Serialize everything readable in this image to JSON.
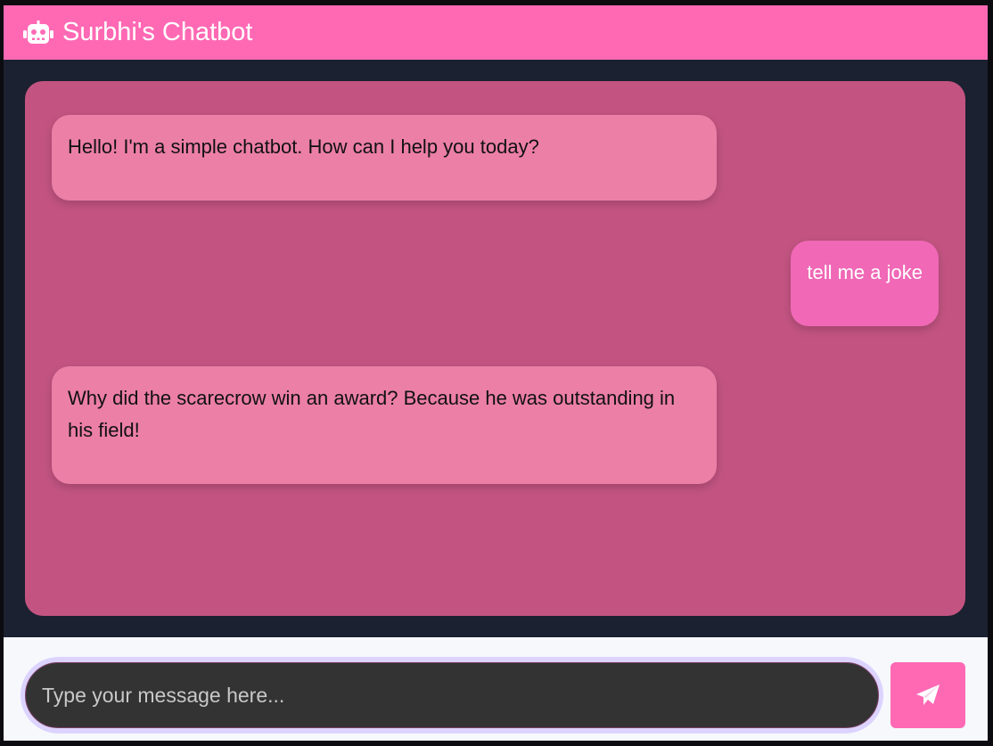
{
  "header": {
    "title": "Surbhi's Chatbot",
    "icon": "robot-icon",
    "background": "#ff69b4"
  },
  "chat": {
    "background": "#c35482",
    "messages": [
      {
        "sender": "bot",
        "text": "Hello! I'm a simple chatbot. How can I help you today?"
      },
      {
        "sender": "user",
        "text": "tell me a joke"
      },
      {
        "sender": "bot",
        "text": "Why did the scarecrow win an award? Because he was outstanding in his field!"
      }
    ]
  },
  "input": {
    "placeholder": "Type your message here...",
    "value": ""
  },
  "send_button": {
    "icon": "paper-plane-icon",
    "background": "#ff69b4"
  }
}
